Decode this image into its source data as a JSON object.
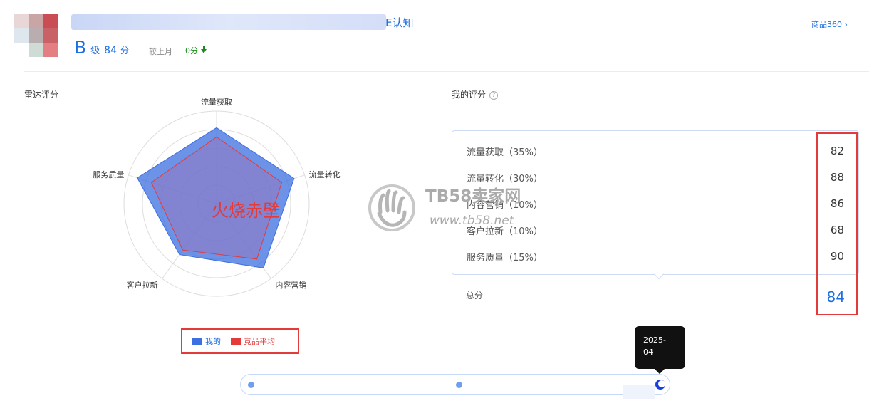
{
  "header": {
    "title_suffix": "E认知",
    "link_label": "商品360",
    "link_chevron": "›",
    "grade_letter": "B",
    "grade_suffix": "级",
    "grade_score": "84",
    "grade_unit": "分",
    "compare_label": "较上月",
    "compare_value": "0分",
    "compare_icon": "arrow-down-icon"
  },
  "radar_section": {
    "title": "雷达评分"
  },
  "score_section": {
    "title": "我的评分",
    "help_icon": "help-circle-icon",
    "help_glyph": "?",
    "total_label": "总分",
    "total_value": "84",
    "items": [
      {
        "label": "流量获取（35%）",
        "value": "82"
      },
      {
        "label": "流量转化（30%）",
        "value": "88"
      },
      {
        "label": "内容营销（10%）",
        "value": "86"
      },
      {
        "label": "客户拉新（10%）",
        "value": "68"
      },
      {
        "label": "服务质量（15%）",
        "value": "90"
      }
    ]
  },
  "watermark": {
    "brand": "TB58卖家网",
    "url": "www.tb58.net",
    "overlay": "火烧赤壁"
  },
  "tooltip": {
    "line1": "2025-",
    "line2": "04"
  },
  "colors": {
    "mine": "#3c6fe0",
    "competitor": "#e33a3a",
    "accent": "#1e6fe0",
    "down": "#1a8a1a"
  },
  "chart_data": {
    "type": "radar",
    "title": "",
    "axes": [
      "流量获取",
      "流量转化",
      "内容营销",
      "客户拉新",
      "服务质量"
    ],
    "rmax": 100,
    "rings": 5,
    "series": [
      {
        "name": "我的",
        "values": [
          82,
          88,
          86,
          68,
          90
        ],
        "color": "#3c6fe0"
      },
      {
        "name": "竞品平均",
        "values": [
          72,
          74,
          74,
          62,
          74
        ],
        "color": "#e33a3a"
      }
    ],
    "legend_position": "bottom"
  }
}
